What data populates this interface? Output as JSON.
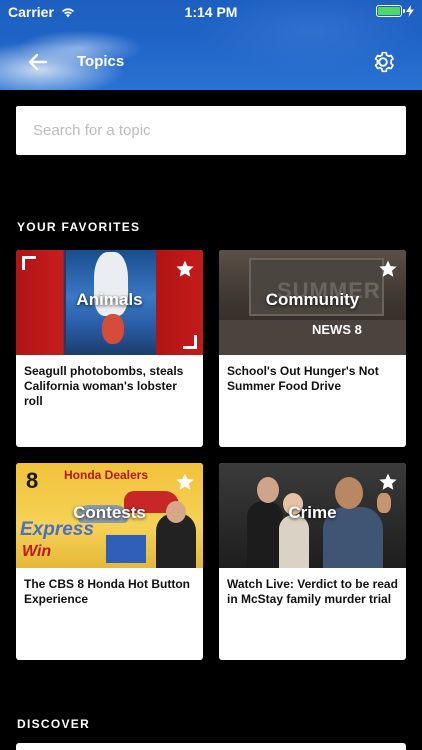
{
  "status_bar": {
    "carrier": "Carrier",
    "time": "1:14 PM",
    "battery_level": 1.0,
    "battery_color": "#4cd964"
  },
  "nav": {
    "back_icon": "arrow-left-icon",
    "title": "Topics",
    "settings_icon": "gear-icon"
  },
  "search": {
    "placeholder": "Search for a topic",
    "value": ""
  },
  "favorites": {
    "heading": "YOUR FAVORITES",
    "items": [
      {
        "topic": "Animals",
        "headline": "Seagull photobombs, steals California woman's lobster roll",
        "favorited": true
      },
      {
        "topic": "Community",
        "headline": "School's Out Hunger's Not Summer Food Drive",
        "favorited": true,
        "image_text": "SUMMER",
        "logo_text": "NEWS 8"
      },
      {
        "topic": "Contests",
        "headline": "The CBS 8 Honda Hot Button Experience",
        "favorited": true,
        "image_text_1": "8",
        "image_text_2": "Honda Dealers",
        "image_text_3": "Express",
        "image_text_4": "Win"
      },
      {
        "topic": "Crime",
        "headline": "Watch Live: Verdict to be read in McStay family murder trial",
        "favorited": true
      }
    ]
  },
  "discover": {
    "heading": "DISCOVER"
  },
  "colors": {
    "header_blue": "#1f63c6",
    "background": "#000000",
    "card_bg": "#ffffff",
    "animals_red": "#c81c1c"
  }
}
